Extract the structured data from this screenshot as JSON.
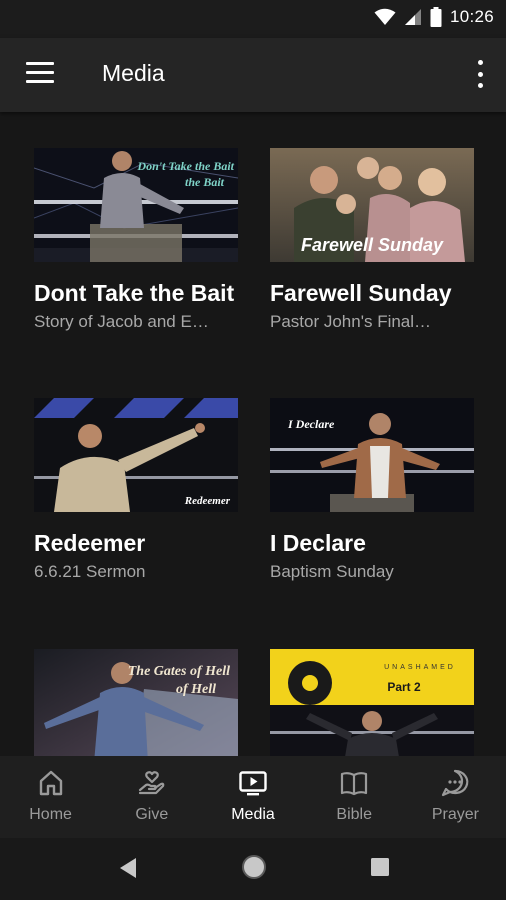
{
  "status": {
    "time": "10:26"
  },
  "app_bar": {
    "title": "Media"
  },
  "media": [
    {
      "title": "Dont Take the Bait",
      "subtitle": "Story of Jacob and E…",
      "overlay": "Don't Take the Bait"
    },
    {
      "title": "Farewell Sunday",
      "subtitle": "Pastor John's Final…",
      "overlay": "Farewell Sunday"
    },
    {
      "title": "Redeemer",
      "subtitle": "6.6.21 Sermon",
      "overlay": "Redeemer"
    },
    {
      "title": "I Declare",
      "subtitle": "Baptism Sunday",
      "overlay": "I Declare"
    },
    {
      "title": "",
      "subtitle": "",
      "overlay": "The Gates of Hell"
    },
    {
      "title": "",
      "subtitle": "",
      "overlay": "Part 2"
    }
  ],
  "bottom_nav": [
    {
      "label": "Home",
      "icon": "home-icon"
    },
    {
      "label": "Give",
      "icon": "give-icon"
    },
    {
      "label": "Media",
      "icon": "media-icon",
      "active": true
    },
    {
      "label": "Bible",
      "icon": "bible-icon"
    },
    {
      "label": "Prayer",
      "icon": "prayer-icon"
    }
  ],
  "colors": {
    "background": "#171717",
    "app_bar": "#252525",
    "accent_yellow": "#f2d21b",
    "inactive": "#9a9a9a"
  }
}
